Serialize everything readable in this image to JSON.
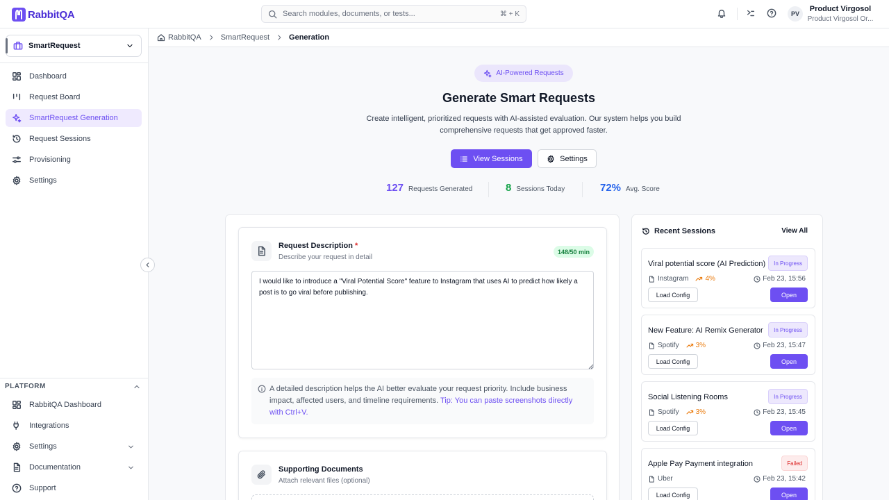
{
  "app": {
    "name": "RabbitQA"
  },
  "search": {
    "placeholder": "Search modules, documents, or tests...",
    "shortcut": "⌘ + K"
  },
  "user": {
    "initials": "PV",
    "name": "Product Virgosol",
    "org": "Product Virgosol Or..."
  },
  "sidebar": {
    "selector_label": "SmartRequest",
    "items": [
      {
        "label": "Dashboard"
      },
      {
        "label": "Request Board"
      },
      {
        "label": "SmartRequest Generation"
      },
      {
        "label": "Request Sessions"
      },
      {
        "label": "Provisioning"
      },
      {
        "label": "Settings"
      }
    ],
    "platform": {
      "label": "PLATFORM",
      "items": [
        {
          "label": "RabbitQA Dashboard"
        },
        {
          "label": "Integrations"
        },
        {
          "label": "Settings"
        },
        {
          "label": "Documentation"
        },
        {
          "label": "Support"
        }
      ]
    }
  },
  "breadcrumb": [
    "RabbitQA",
    "SmartRequest",
    "Generation"
  ],
  "hero": {
    "badge": "AI-Powered Requests",
    "title": "Generate Smart Requests",
    "description": "Create intelligent, prioritized requests with AI-assisted evaluation. Our system helps you build comprehensive requests that get approved faster.",
    "view_sessions": "View Sessions",
    "settings": "Settings"
  },
  "stats": [
    {
      "value": "127",
      "label": "Requests Generated",
      "color": "#6d4ff2"
    },
    {
      "value": "8",
      "label": "Sessions Today",
      "color": "#16a34a"
    },
    {
      "value": "72%",
      "label": "Avg. Score",
      "color": "#2563eb"
    }
  ],
  "request": {
    "title": "Request Description",
    "required": "*",
    "subtitle": "Describe your request in detail",
    "count": "148/50 min",
    "text": "I would like to introduce a \"Viral Potential Score\" feature to Instagram that uses AI to predict how likely a post is to go viral before publishing.",
    "hint": "A detailed description helps the AI better evaluate your request priority. Include business impact, affected users, and timeline requirements.",
    "tip": "Tip: You can paste screenshots directly with Ctrl+V."
  },
  "documents": {
    "title": "Supporting Documents",
    "subtitle": "Attach relevant files (optional)"
  },
  "recent": {
    "title": "Recent Sessions",
    "view_all": "View All",
    "load_label": "Load Config",
    "open_label": "Open",
    "sessions": [
      {
        "name": "Viral potential score (AI Prediction)",
        "status": "In Progress",
        "platform": "Instagram",
        "score": "4%",
        "date": "Feb 23, 15:56"
      },
      {
        "name": "New Feature: AI Remix Generator",
        "status": "In Progress",
        "platform": "Spotify",
        "score": "3%",
        "date": "Feb 23, 15:47"
      },
      {
        "name": "Social Listening Rooms",
        "status": "In Progress",
        "platform": "Spotify",
        "score": "3%",
        "date": "Feb 23, 15:45"
      },
      {
        "name": "Apple Pay Payment integration",
        "status": "Failed",
        "platform": "Uber",
        "score": "",
        "date": "Feb 23, 15:42"
      }
    ]
  }
}
